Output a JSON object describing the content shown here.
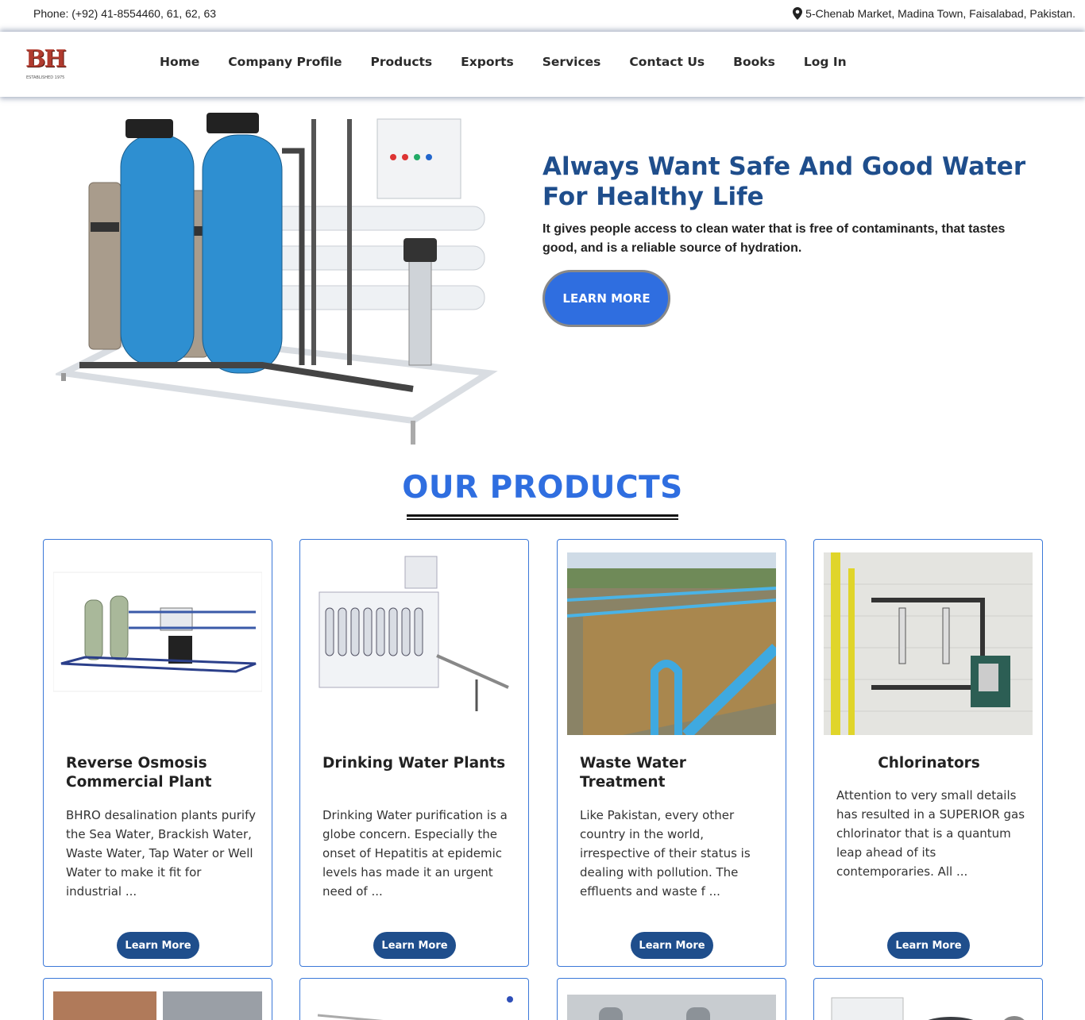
{
  "topbar": {
    "phone": "Phone: (+92) 41-8554460, 61, 62, 63",
    "address": "5-Chenab Market, Madina Town, Faisalabad, Pakistan.",
    "address_icon": "map-marker-icon"
  },
  "logo": {
    "text": "BH",
    "subtitle": "ESTABLISHED 1975"
  },
  "nav": {
    "items": [
      {
        "label": "Home"
      },
      {
        "label": "Company Profile"
      },
      {
        "label": "Products"
      },
      {
        "label": "Exports"
      },
      {
        "label": "Services"
      },
      {
        "label": "Contact Us"
      },
      {
        "label": "Books"
      },
      {
        "label": "Log In"
      }
    ]
  },
  "hero": {
    "title": "Always Want Safe And Good Water For Healthy Life",
    "subtitle": "It gives people access to clean water that is free of contaminants, that tastes good, and is a reliable source of hydration.",
    "button": "LEARN MORE"
  },
  "products_section": {
    "title": "OUR PRODUCTS",
    "cards": [
      {
        "title": "Reverse Osmosis Commercial Plant",
        "text": "BHRO desalination plants purify the Sea Water, Brackish Water, Waste Water, Tap Water or Well Water to make it fit for industrial ...",
        "button": "Learn More"
      },
      {
        "title": "Drinking Water Plants",
        "text": "Drinking Water purification is a globe concern. Especially the onset of Hepatitis at epidemic levels has made it an urgent need of ...",
        "button": "Learn More"
      },
      {
        "title": "Waste Water Treatment",
        "text": "Like Pakistan, every other country in the world, irrespective of their status is dealing with pollution. The effluents and waste f ...",
        "button": "Learn More"
      },
      {
        "title": "Chlorinators",
        "text": "Attention to very small details has resulted in a SUPERIOR gas chlorinator that is a quantum leap ahead of its contemporaries. All ...",
        "button": "Learn More"
      }
    ]
  },
  "colors": {
    "brand_blue": "#1f4e8c",
    "accent_blue": "#2f6ee0",
    "card_border": "#3b78d8",
    "logo_red": "#b03a2e"
  }
}
